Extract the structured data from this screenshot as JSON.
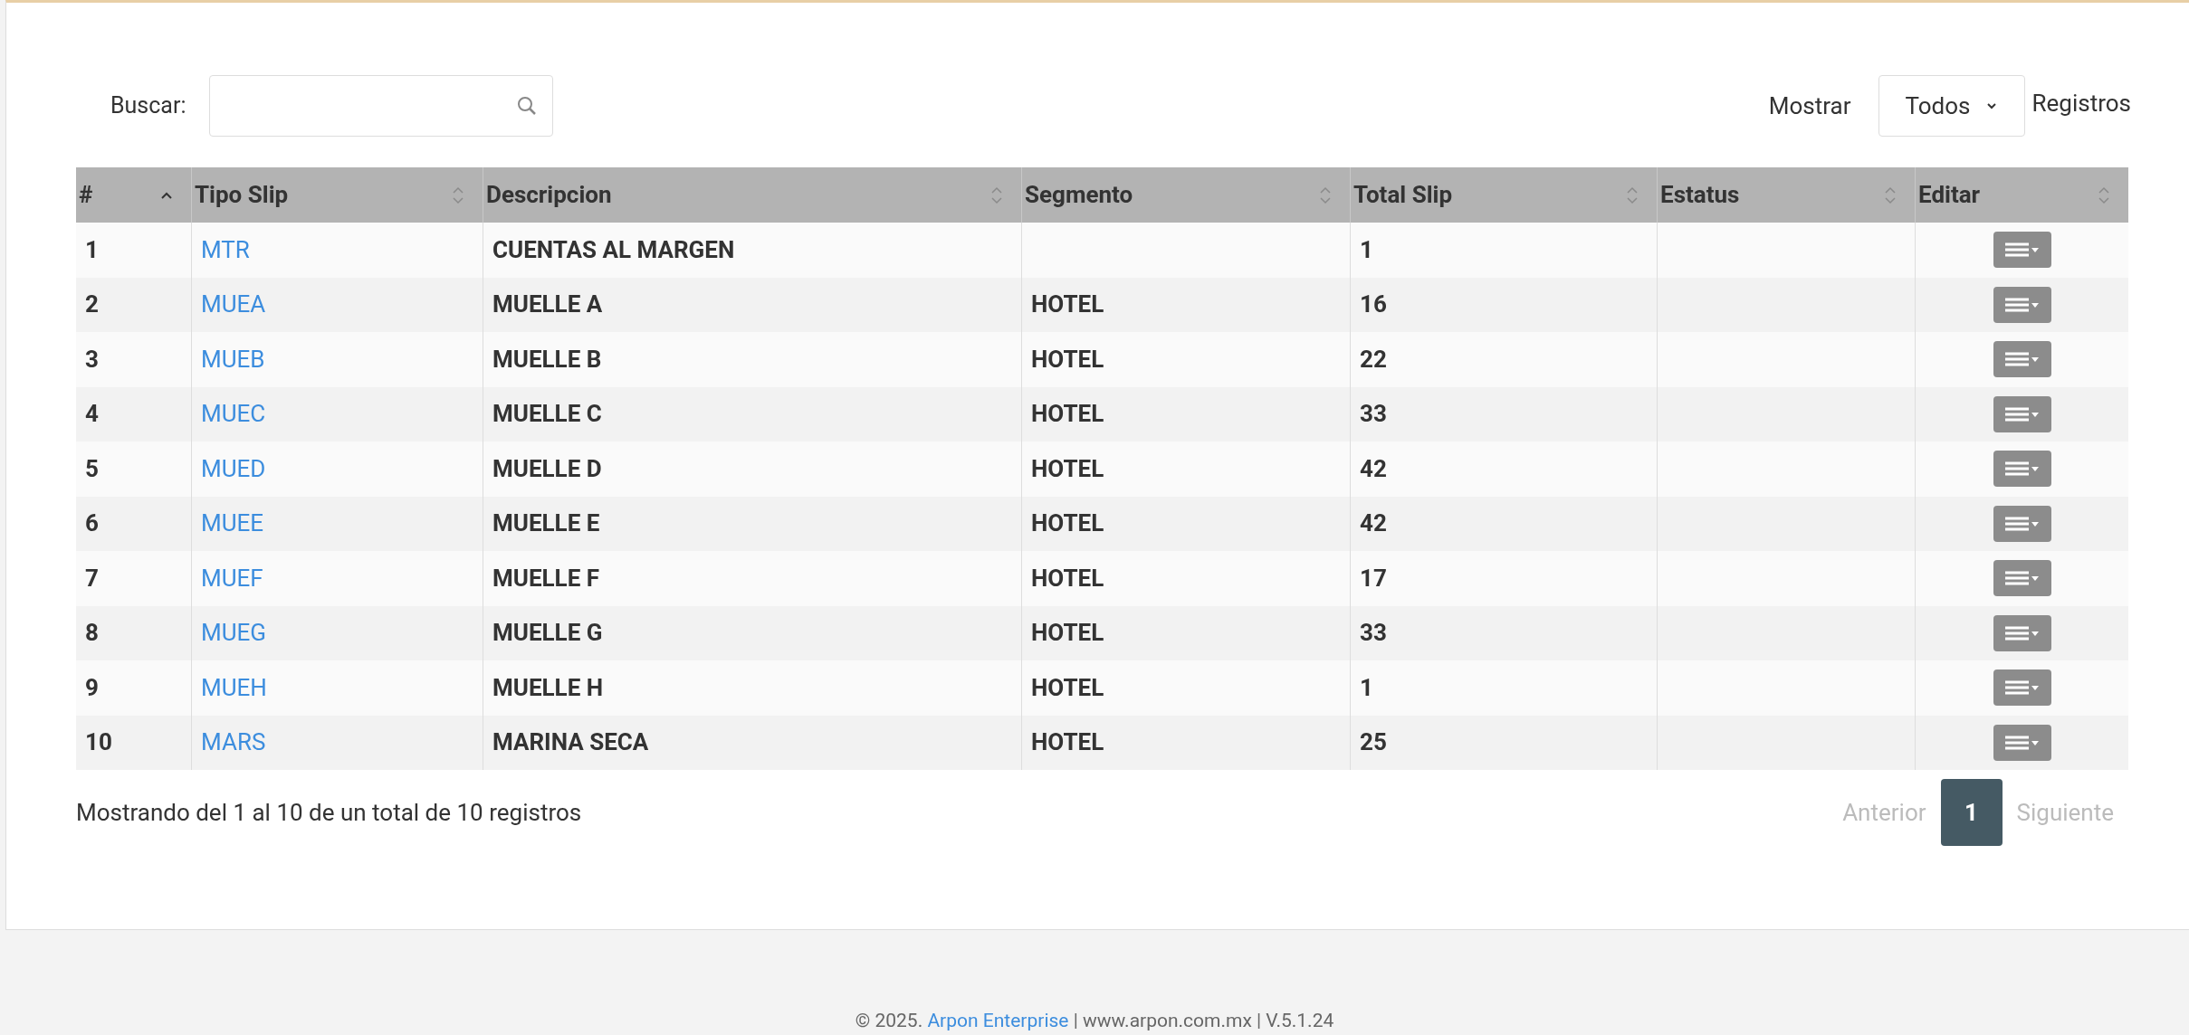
{
  "search": {
    "label": "Buscar:"
  },
  "length": {
    "label": "Mostrar",
    "value": "Todos",
    "suffix": "Registros"
  },
  "table": {
    "columns": [
      {
        "label": "#",
        "sorted": true
      },
      {
        "label": "Tipo Slip",
        "sorted": false
      },
      {
        "label": "Descripcion",
        "sorted": false
      },
      {
        "label": "Segmento",
        "sorted": false
      },
      {
        "label": "Total Slip",
        "sorted": false
      },
      {
        "label": "Estatus",
        "sorted": false
      },
      {
        "label": "Editar",
        "sorted": false
      }
    ],
    "rows": [
      {
        "num": "1",
        "tipo": "MTR",
        "descripcion": "CUENTAS AL MARGEN",
        "total": "1"
      },
      {
        "num": "2",
        "tipo": "MUEA",
        "descripcion": "MUELLE A",
        "segmento": "HOTEL",
        "total": "16"
      },
      {
        "num": "3",
        "tipo": "MUEB",
        "descripcion": "MUELLE B",
        "segmento": "HOTEL",
        "total": "22"
      },
      {
        "num": "4",
        "tipo": "MUEC",
        "descripcion": "MUELLE C",
        "segmento": "HOTEL",
        "total": "33"
      },
      {
        "num": "5",
        "tipo": "MUED",
        "descripcion": "MUELLE D",
        "segmento": "HOTEL",
        "total": "42"
      },
      {
        "num": "6",
        "tipo": "MUEE",
        "descripcion": "MUELLE E",
        "segmento": "HOTEL",
        "total": "42"
      },
      {
        "num": "7",
        "tipo": "MUEF",
        "descripcion": "MUELLE F",
        "segmento": "HOTEL",
        "total": "17"
      },
      {
        "num": "8",
        "tipo": "MUEG",
        "descripcion": "MUELLE G",
        "segmento": "HOTEL",
        "total": "33"
      },
      {
        "num": "9",
        "tipo": "MUEH",
        "descripcion": "MUELLE H",
        "segmento": "HOTEL",
        "total": "1"
      },
      {
        "num": "10",
        "tipo": "MARS",
        "descripcion": "MARINA SECA",
        "segmento": "HOTEL",
        "total": "25"
      }
    ]
  },
  "info": "Mostrando del 1 al 10 de un total de 10 registros",
  "pagination": {
    "previous": "Anterior",
    "pages": [
      {
        "label": "1",
        "selected": true
      }
    ],
    "next": "Siguiente"
  },
  "footer": {
    "prefix": "© 2025.",
    "link": "Arpon Enterprise",
    "suffix": "| www.arpon.com.mx | V.5.1.24"
  }
}
